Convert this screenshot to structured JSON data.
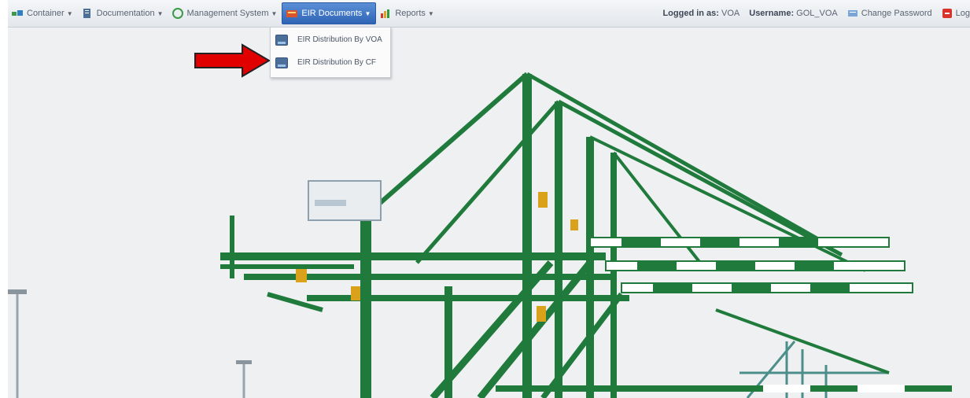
{
  "topbar": {
    "menu": [
      {
        "label": "Container",
        "icon": "container-icon",
        "active": false
      },
      {
        "label": "Documentation",
        "icon": "documentation-icon",
        "active": false
      },
      {
        "label": "Management System",
        "icon": "management-system-icon",
        "active": false
      },
      {
        "label": "EIR Documents",
        "icon": "eir-documents-icon",
        "active": true
      },
      {
        "label": "Reports",
        "icon": "reports-icon",
        "active": false
      }
    ],
    "logged_in_label": "Logged in as:",
    "logged_in_value": "VOA",
    "username_label": "Username:",
    "username_value": "GOL_VOA",
    "change_password": "Change Password",
    "logout": "Log"
  },
  "dropdown": {
    "items": [
      {
        "label": "EIR Distribution By VOA",
        "icon": "document-icon"
      },
      {
        "label": "EIR Distribution By CF",
        "icon": "document-icon"
      }
    ]
  },
  "colors": {
    "crane_green": "#1f7a3c",
    "stripe_white": "#ffffff",
    "sky": "#eef0f2",
    "arrow_red": "#e10000",
    "active_menu": "#3a70c4"
  }
}
